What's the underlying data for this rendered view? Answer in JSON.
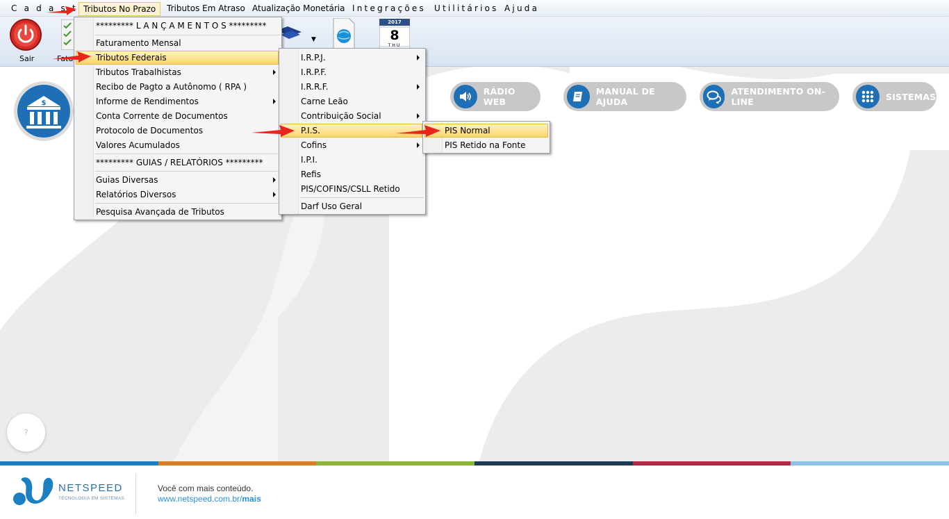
{
  "menubar": {
    "items": [
      {
        "label": "C a d a s t",
        "id": "cadastros"
      },
      {
        "label": "Tributos No Prazo",
        "id": "tributos-no-prazo"
      },
      {
        "label": "Tributos Em Atraso",
        "id": "tributos-em-atraso"
      },
      {
        "label": "Atualização Monetária",
        "id": "atualizacao-monetaria"
      },
      {
        "label": "Integrações",
        "id": "integracoes"
      },
      {
        "label": "Utilitários",
        "id": "utilitarios"
      },
      {
        "label": "Ajuda",
        "id": "ajuda"
      }
    ]
  },
  "toolbar": {
    "sair_label": "Sair",
    "fatura_label": "Fatur",
    "calendar_year": "2017",
    "calendar_day": "8",
    "calendar_weekday": "THU"
  },
  "header_buttons": {
    "radio": "RÁDIO WEB",
    "manual": "MANUAL DE AJUDA",
    "atendimento": "ATENDIMENTO ON-LINE",
    "sistemas": "SISTEMAS"
  },
  "menu1": {
    "items": [
      "********* L A N Ç A M E N T O S *********",
      "Faturamento Mensal",
      "Tributos Federais",
      "Tributos Trabalhistas",
      "Recibo de Pagto a Autônomo ( RPA )",
      "Informe de Rendimentos",
      "Conta Corrente de Documentos",
      "Protocolo de Documentos",
      "Valores Acumulados",
      "********* GUIAS / RELATÓRIOS *********",
      "Guias Diversas",
      "Relatórios Diversos",
      "Pesquisa Avançada de Tributos"
    ]
  },
  "menu2": {
    "items": [
      "I.R.P.J.",
      "I.R.P.F.",
      "I.R.R.F.",
      "Carne Leão",
      "Contribuição Social",
      "P.I.S.",
      "Cofins",
      "I.P.I.",
      "Refis",
      "PIS/COFINS/CSLL Retido",
      "Darf Uso Geral"
    ]
  },
  "menu3": {
    "items": [
      "PIS Normal",
      "PIS Retido na Fonte"
    ]
  },
  "help_bubble": "?",
  "footer": {
    "brand": "NETSPEED",
    "tagline": "TECNOLOGIA EM SISTEMAS",
    "message": "Você com mais conteúdo.",
    "url_prefix": "www.netspeed.com.br/",
    "url_bold": "mais"
  },
  "colors": {
    "accent_blue": "#1f6fb6",
    "pill_gray": "#c8c8c8",
    "highlight": "#fbd46a",
    "arrow_red": "#e8251c",
    "stripes": [
      "#1c7fc1",
      "#d6802b",
      "#8db43c",
      "#1d3b57",
      "#b12b47",
      "#8dc2e6"
    ]
  }
}
